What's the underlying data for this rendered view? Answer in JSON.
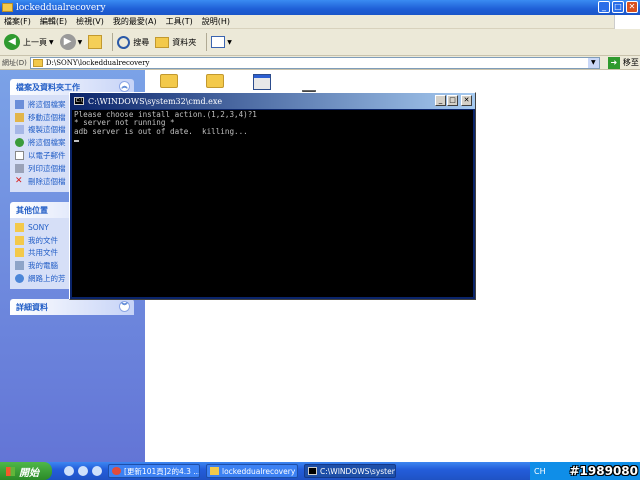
{
  "explorer": {
    "title": "lockeddualrecovery",
    "menu": [
      "檔案(F)",
      "編輯(E)",
      "檢視(V)",
      "我的最愛(A)",
      "工具(T)",
      "說明(H)"
    ],
    "toolbar": {
      "back_label": "上一頁",
      "search_label": "搜尋",
      "folders_label": "資料夾"
    },
    "address": {
      "label": "網址(D)",
      "value": "D:\\SONY\\lockeddualrecovery",
      "go_label": "移至"
    }
  },
  "sidebar": {
    "tasks_panel": {
      "title": "檔案及資料夾工作",
      "items": [
        "將這個檔案",
        "移動這個檔",
        "複製這個檔",
        "將這個檔案",
        "以電子郵件",
        "列印這個檔",
        "刪除這個檔"
      ]
    },
    "places_panel": {
      "title": "其他位置",
      "items": [
        "SONY",
        "我的文件",
        "共用文件",
        "我的電腦",
        "網路上的芳"
      ]
    },
    "details_panel": {
      "title": "詳細資料"
    }
  },
  "cmd": {
    "title": "C:\\WINDOWS\\system32\\cmd.exe",
    "lines": [
      "Please choose install action.(1,2,3,4)?1",
      "* server not running *",
      "adb server is out of date.  killing..."
    ]
  },
  "taskbar": {
    "start_label": "開始",
    "tasks": [
      "[更新101頁]2的4.3 ...",
      "lockeddualrecovery",
      "C:\\WINDOWS\\system..."
    ],
    "lang": "CH"
  },
  "watermark": "#1989080"
}
